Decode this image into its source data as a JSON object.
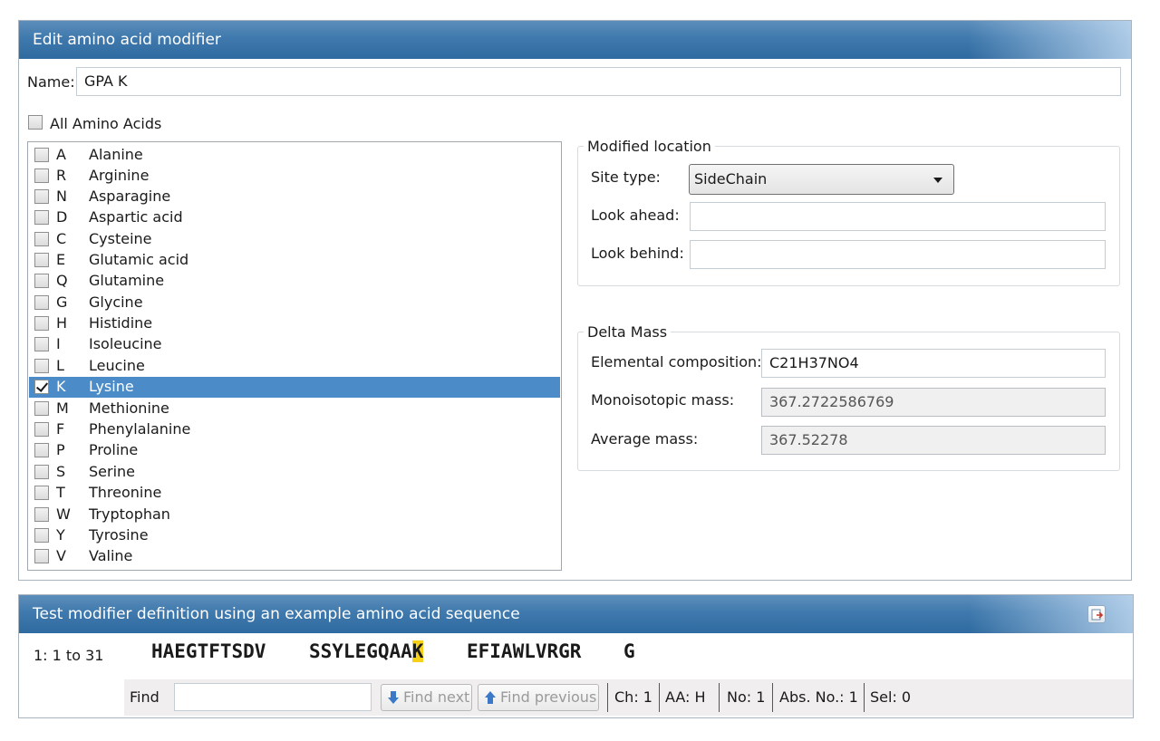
{
  "window": {
    "title": "Edit amino acid modifier"
  },
  "name_field": {
    "label": "Name:",
    "value": "GPA K"
  },
  "all_amino_acids": {
    "label": "All Amino Acids",
    "checked": false
  },
  "amino_acids": [
    {
      "code": "A",
      "name": "Alanine",
      "checked": false
    },
    {
      "code": "R",
      "name": "Arginine",
      "checked": false
    },
    {
      "code": "N",
      "name": "Asparagine",
      "checked": false
    },
    {
      "code": "D",
      "name": "Aspartic acid",
      "checked": false
    },
    {
      "code": "C",
      "name": "Cysteine",
      "checked": false
    },
    {
      "code": "E",
      "name": "Glutamic acid",
      "checked": false
    },
    {
      "code": "Q",
      "name": "Glutamine",
      "checked": false
    },
    {
      "code": "G",
      "name": "Glycine",
      "checked": false
    },
    {
      "code": "H",
      "name": "Histidine",
      "checked": false
    },
    {
      "code": "I",
      "name": "Isoleucine",
      "checked": false
    },
    {
      "code": "L",
      "name": "Leucine",
      "checked": false
    },
    {
      "code": "K",
      "name": "Lysine",
      "checked": true,
      "selected": true
    },
    {
      "code": "M",
      "name": "Methionine",
      "checked": false
    },
    {
      "code": "F",
      "name": "Phenylalanine",
      "checked": false
    },
    {
      "code": "P",
      "name": "Proline",
      "checked": false
    },
    {
      "code": "S",
      "name": "Serine",
      "checked": false
    },
    {
      "code": "T",
      "name": "Threonine",
      "checked": false
    },
    {
      "code": "W",
      "name": "Tryptophan",
      "checked": false
    },
    {
      "code": "Y",
      "name": "Tyrosine",
      "checked": false
    },
    {
      "code": "V",
      "name": "Valine",
      "checked": false
    }
  ],
  "modified_location": {
    "title": "Modified location",
    "site_type_label": "Site type:",
    "site_type_value": "SideChain",
    "look_ahead_label": "Look ahead:",
    "look_ahead_value": "",
    "look_behind_label": "Look behind:",
    "look_behind_value": ""
  },
  "delta_mass": {
    "title": "Delta Mass",
    "elemental_label": "Elemental composition:",
    "elemental_value": "C21H37NO4",
    "mono_label": "Monoisotopic mass:",
    "mono_value": "367.2722586769",
    "avg_label": "Average mass:",
    "avg_value": "367.52278"
  },
  "test_panel": {
    "title": "Test modifier definition using an example amino acid sequence",
    "icon": "export-icon",
    "range_label": "1: 1 to 31",
    "seq_group1": "HAEGTFTSDV",
    "seq_group2_pre": "SSYLEGQAA",
    "seq_group2_hl": "K",
    "seq_group3": "EFIAWLVRGR",
    "seq_group4": "G",
    "highlight_color": "#f7d117",
    "find_label": "Find",
    "find_value": "",
    "find_next": "Find next",
    "find_previous": "Find previous",
    "status": {
      "ch": "Ch: 1",
      "aa": "AA: H",
      "no": "No: 1",
      "abs": "Abs. No.: 1",
      "sel": "Sel: 0"
    }
  }
}
